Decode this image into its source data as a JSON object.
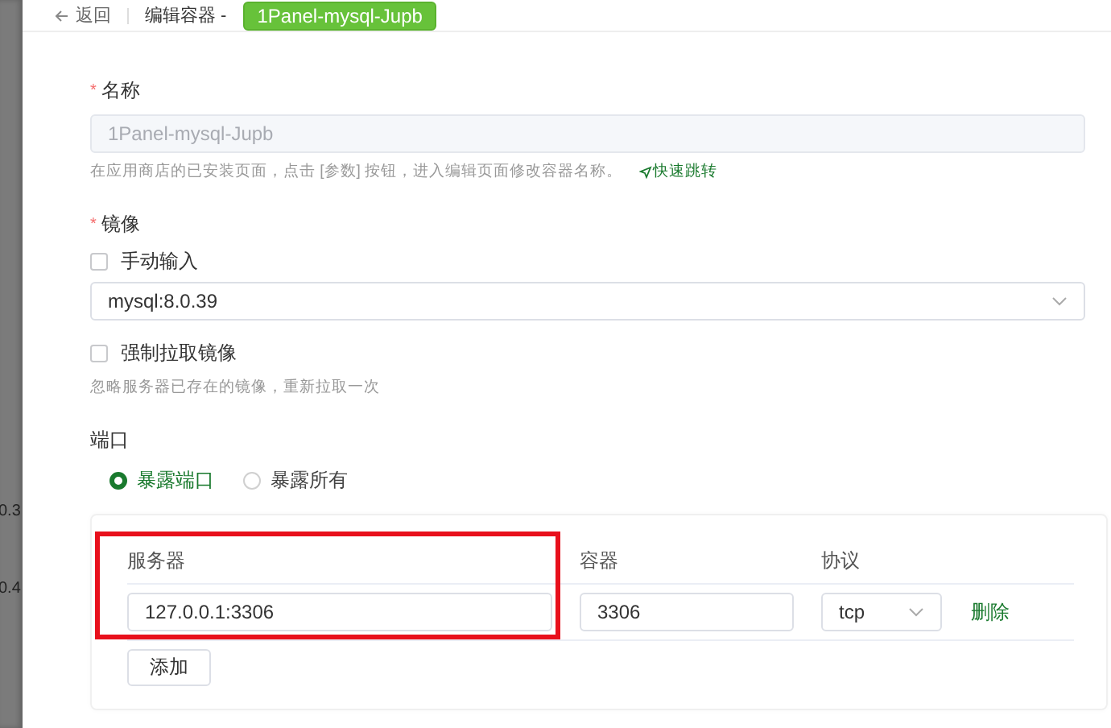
{
  "left_strip": {
    "values": [
      "0.3",
      "0.4"
    ]
  },
  "header": {
    "back": "返回",
    "title": "编辑容器 -",
    "tag": "1Panel-mysql-Jupb"
  },
  "form": {
    "name": {
      "label": "名称",
      "required_mark": "*",
      "value": "1Panel-mysql-Jupb",
      "disabled": true,
      "hint": "在应用商店的已安装页面，点击 [参数] 按钮，进入编辑页面修改容器名称。",
      "link": "快速跳转"
    },
    "image": {
      "label": "镜像",
      "required_mark": "*",
      "manual": {
        "label": "手动输入",
        "checked": false
      },
      "value": "mysql:8.0.39"
    },
    "force_pull": {
      "label": "强制拉取镜像",
      "checked": false,
      "hint": "忽略服务器已存在的镜像，重新拉取一次"
    },
    "ports": {
      "label": "端口",
      "options": [
        {
          "label": "暴露端口",
          "selected": true
        },
        {
          "label": "暴露所有",
          "selected": false
        }
      ],
      "columns": [
        "服务器",
        "容器",
        "协议"
      ],
      "rows": [
        {
          "server": "127.0.0.1:3306",
          "container": "3306",
          "protocol": "tcp",
          "action": "删除"
        }
      ],
      "add_button": "添加",
      "highlight_server_column": true
    }
  }
}
